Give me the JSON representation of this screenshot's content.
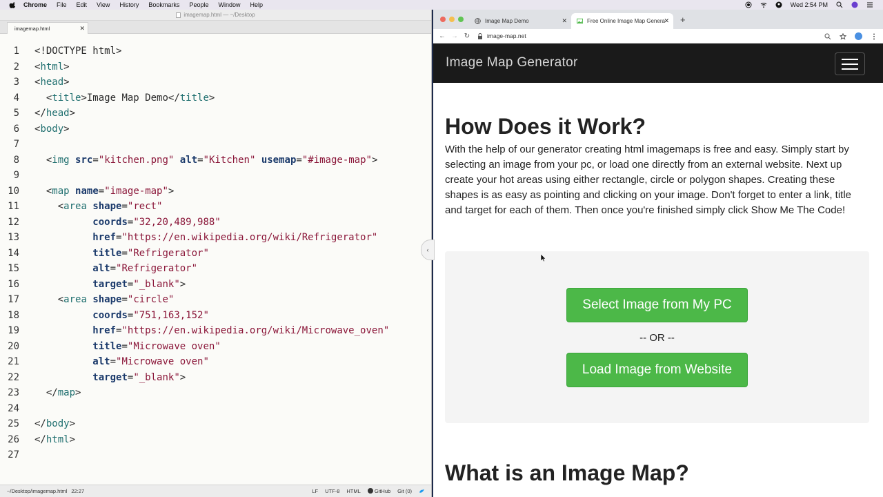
{
  "menubar": {
    "app": "Chrome",
    "items": [
      "File",
      "Edit",
      "View",
      "History",
      "Bookmarks",
      "People",
      "Window",
      "Help"
    ],
    "clock": "Wed 2:54 PM"
  },
  "editor": {
    "window_title": "imagemap.html — ~/Desktop",
    "tab_label": "imagemap.html",
    "lines": [
      {
        "n": "1",
        "parts": [
          [
            "t",
            "<!DOCTYPE html>"
          ]
        ]
      },
      {
        "n": "2",
        "parts": [
          [
            "t",
            "<"
          ],
          [
            "tn",
            "html"
          ],
          [
            "t",
            ">"
          ]
        ]
      },
      {
        "n": "3",
        "parts": [
          [
            "t",
            "<"
          ],
          [
            "tn",
            "head"
          ],
          [
            "t",
            ">"
          ]
        ]
      },
      {
        "n": "4",
        "parts": [
          [
            "t",
            "  <"
          ],
          [
            "tn",
            "title"
          ],
          [
            "t",
            ">Image Map Demo</"
          ],
          [
            "tn",
            "title"
          ],
          [
            "t",
            ">"
          ]
        ]
      },
      {
        "n": "5",
        "parts": [
          [
            "t",
            "</"
          ],
          [
            "tn",
            "head"
          ],
          [
            "t",
            ">"
          ]
        ]
      },
      {
        "n": "6",
        "parts": [
          [
            "t",
            "<"
          ],
          [
            "tn",
            "body"
          ],
          [
            "t",
            ">"
          ]
        ]
      },
      {
        "n": "7",
        "parts": []
      },
      {
        "n": "8",
        "parts": [
          [
            "t",
            "  <"
          ],
          [
            "tn",
            "img"
          ],
          [
            "t",
            " "
          ],
          [
            "an",
            "src"
          ],
          [
            "t",
            "="
          ],
          [
            "av",
            "\"kitchen.png\""
          ],
          [
            "t",
            " "
          ],
          [
            "an",
            "alt"
          ],
          [
            "t",
            "="
          ],
          [
            "av",
            "\"Kitchen\""
          ],
          [
            "t",
            " "
          ],
          [
            "an",
            "usemap"
          ],
          [
            "t",
            "="
          ],
          [
            "av",
            "\"#image-map\""
          ],
          [
            "t",
            ">"
          ]
        ]
      },
      {
        "n": "9",
        "parts": []
      },
      {
        "n": "10",
        "parts": [
          [
            "t",
            "  <"
          ],
          [
            "tn",
            "map"
          ],
          [
            "t",
            " "
          ],
          [
            "an",
            "name"
          ],
          [
            "t",
            "="
          ],
          [
            "av",
            "\"image-map\""
          ],
          [
            "t",
            ">"
          ]
        ]
      },
      {
        "n": "11",
        "parts": [
          [
            "t",
            "    <"
          ],
          [
            "tn",
            "area"
          ],
          [
            "t",
            " "
          ],
          [
            "an",
            "shape"
          ],
          [
            "t",
            "="
          ],
          [
            "av",
            "\"rect\""
          ]
        ]
      },
      {
        "n": "12",
        "parts": [
          [
            "t",
            "          "
          ],
          [
            "an",
            "coords"
          ],
          [
            "t",
            "="
          ],
          [
            "av",
            "\"32,20,489,988\""
          ]
        ]
      },
      {
        "n": "13",
        "parts": [
          [
            "t",
            "          "
          ],
          [
            "an",
            "href"
          ],
          [
            "t",
            "="
          ],
          [
            "av",
            "\"https://en.wikipedia.org/wiki/Refrigerator\""
          ]
        ]
      },
      {
        "n": "14",
        "parts": [
          [
            "t",
            "          "
          ],
          [
            "an",
            "title"
          ],
          [
            "t",
            "="
          ],
          [
            "av",
            "\"Refrigerator\""
          ]
        ]
      },
      {
        "n": "15",
        "parts": [
          [
            "t",
            "          "
          ],
          [
            "an",
            "alt"
          ],
          [
            "t",
            "="
          ],
          [
            "av",
            "\"Refrigerator\""
          ]
        ]
      },
      {
        "n": "16",
        "parts": [
          [
            "t",
            "          "
          ],
          [
            "an",
            "target"
          ],
          [
            "t",
            "="
          ],
          [
            "av",
            "\"_blank\""
          ],
          [
            "t",
            ">"
          ]
        ]
      },
      {
        "n": "17",
        "parts": [
          [
            "t",
            "    <"
          ],
          [
            "tn",
            "area"
          ],
          [
            "t",
            " "
          ],
          [
            "an",
            "shape"
          ],
          [
            "t",
            "="
          ],
          [
            "av",
            "\"circle\""
          ]
        ]
      },
      {
        "n": "18",
        "parts": [
          [
            "t",
            "          "
          ],
          [
            "an",
            "coords"
          ],
          [
            "t",
            "="
          ],
          [
            "av",
            "\"751,163,152\""
          ]
        ]
      },
      {
        "n": "19",
        "parts": [
          [
            "t",
            "          "
          ],
          [
            "an",
            "href"
          ],
          [
            "t",
            "="
          ],
          [
            "av",
            "\"https://en.wikipedia.org/wiki/Microwave_oven\""
          ]
        ]
      },
      {
        "n": "20",
        "parts": [
          [
            "t",
            "          "
          ],
          [
            "an",
            "title"
          ],
          [
            "t",
            "="
          ],
          [
            "av",
            "\"Microwave oven\""
          ]
        ]
      },
      {
        "n": "21",
        "parts": [
          [
            "t",
            "          "
          ],
          [
            "an",
            "alt"
          ],
          [
            "t",
            "="
          ],
          [
            "av",
            "\"Microwave oven\""
          ]
        ]
      },
      {
        "n": "22",
        "parts": [
          [
            "t",
            "          "
          ],
          [
            "an",
            "target"
          ],
          [
            "t",
            "="
          ],
          [
            "av",
            "\"_blank\""
          ],
          [
            "t",
            ">"
          ]
        ]
      },
      {
        "n": "23",
        "parts": [
          [
            "t",
            "  </"
          ],
          [
            "tn",
            "map"
          ],
          [
            "t",
            ">"
          ]
        ]
      },
      {
        "n": "24",
        "parts": []
      },
      {
        "n": "25",
        "parts": [
          [
            "t",
            "</"
          ],
          [
            "tn",
            "body"
          ],
          [
            "t",
            ">"
          ]
        ]
      },
      {
        "n": "26",
        "parts": [
          [
            "t",
            "</"
          ],
          [
            "tn",
            "html"
          ],
          [
            "t",
            ">"
          ]
        ]
      },
      {
        "n": "27",
        "parts": []
      }
    ],
    "status": {
      "path": "~/Desktop/imagemap.html",
      "cursor": "22:27",
      "eol": "LF",
      "encoding": "UTF-8",
      "grammar": "HTML",
      "github": "GitHub",
      "git": "Git (0)"
    }
  },
  "browser": {
    "tabs": [
      {
        "label": "Image Map Demo"
      },
      {
        "label": "Free Online Image Map Genera"
      }
    ],
    "url": "image-map.net"
  },
  "site": {
    "brand": "Image Map Generator",
    "h_how": "How Does it Work?",
    "p_how": "With the help of our generator creating html imagemaps is free and easy. Simply start by selecting an image from your pc, or load one directly from an external website. Next up create your hot areas using either rectangle, circle or polygon shapes. Creating these shapes is as easy as pointing and clicking on your image. Don't forget to enter a link, title and target for each of them. Then once you're finished simply click Show Me The Code!",
    "btn_select": "Select Image from My PC",
    "or_text": "-- OR --",
    "btn_load": "Load Image from Website",
    "h_what": "What is an Image Map?"
  },
  "colors": {
    "navbar_bg": "#1a1a1a",
    "button_green": "#4cb848",
    "code_tag": "#1f6f6f",
    "code_attr": "#1b3a6b",
    "code_value": "#8a1538"
  }
}
